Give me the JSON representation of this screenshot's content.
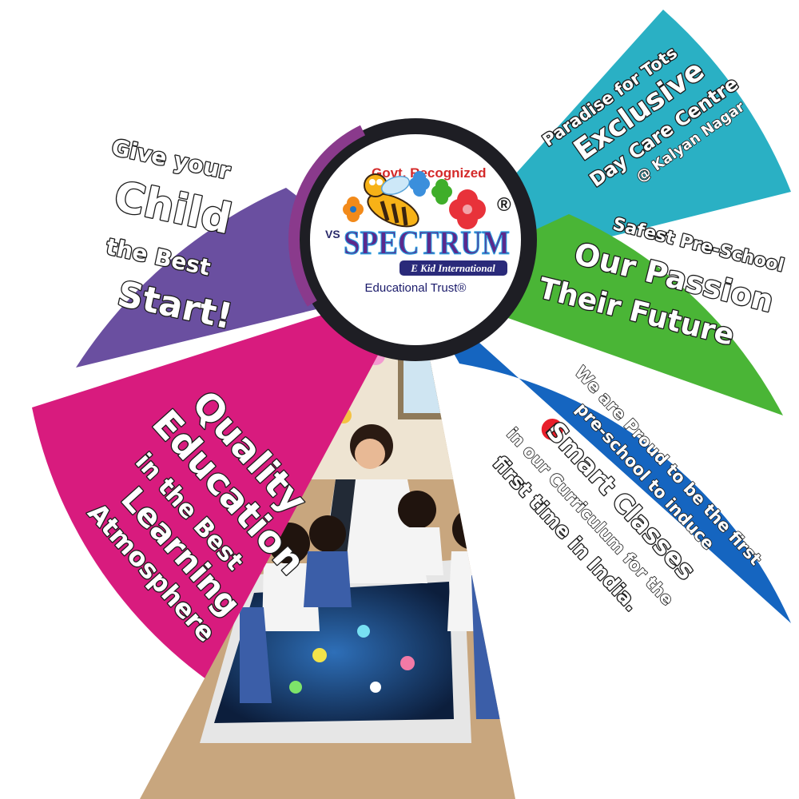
{
  "logo": {
    "recognition": "Govt. Recognized",
    "prefix": "VS",
    "name": "SPECTRUM",
    "tagline": "E Kid International",
    "trust": "Educational Trust®",
    "registered": "®"
  },
  "panels": {
    "child": {
      "l1": "Give your",
      "l2": "Child",
      "l3": "the Best",
      "l4": "Start!"
    },
    "quality": {
      "l1": "Quality",
      "l2": "Education",
      "l3": "in the Best",
      "l4": "Learning",
      "l5": "Atmosphere"
    },
    "daycare": {
      "l1": "Paradise for Tots",
      "l2": "Exclusive",
      "l3": "Day Care Centre",
      "l4": "@ Kalyan Nagar"
    },
    "passion": {
      "l1": "Safest Pre-School",
      "l2": "Our Passion",
      "l3": "Their Future"
    },
    "smart": {
      "l1": "We are Proud to be the first",
      "l2": "pre-school to induce",
      "l3": "i",
      "l4": "Smart Classes",
      "l5": "in our Curriculum for the",
      "l6": "first time in India."
    }
  },
  "colors": {
    "purple": "#6a4fa0",
    "magenta": "#d81b7e",
    "teal": "#2ab0c4",
    "green": "#4ab536",
    "blue": "#1565c0",
    "dark": "#1a1a1a"
  }
}
